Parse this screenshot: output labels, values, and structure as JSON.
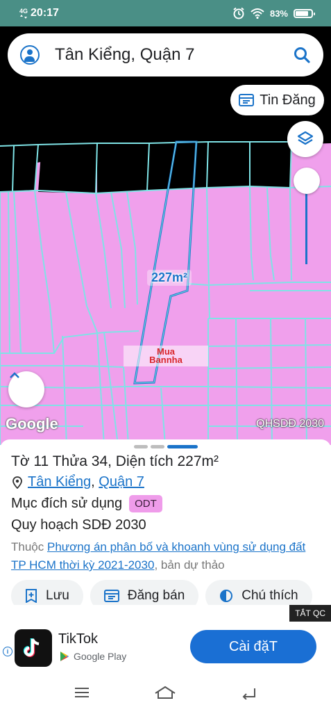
{
  "status_bar": {
    "network": "4G",
    "time": "20:17",
    "battery": "83%",
    "battery_level": 0.83
  },
  "search": {
    "query": "Tân Kiểng, Quận 7"
  },
  "map": {
    "tin_dang_label": "Tin Đăng",
    "area_label": "227m²",
    "watermark_line1": "Mua",
    "watermark_line2": "Bannha",
    "google_label": "Google",
    "layer_label": "QHSDĐ 2030"
  },
  "sheet": {
    "title": "Tờ 11 Thửa 34, Diện tích 227m²",
    "ward": "Tân Kiểng",
    "separator": ",",
    "district": "Quận 7",
    "purpose_label": "Mục đích sử dụng",
    "purpose_badge": "ODT",
    "plan_title": "Quy hoạch SDĐ 2030",
    "belongs_prefix": "Thuộc",
    "belongs_link": "Phương án phân bố và khoanh vùng sử dụng đất TP HCM thời kỳ 2021-2030",
    "belongs_suffix": ", bản dự thảo",
    "actions": [
      {
        "label": "Lưu",
        "icon": "bookmark-plus-icon"
      },
      {
        "label": "Đăng bán",
        "icon": "listing-icon"
      },
      {
        "label": "Chú thích",
        "icon": "contrast-icon"
      }
    ]
  },
  "ad": {
    "close_label": "TẮT QC",
    "app_name": "TikTok",
    "store": "Google Play",
    "install_label": "Cài đặT"
  },
  "colors": {
    "accent": "#1a73c9",
    "map_pink": "#f0a0ec",
    "parcel_line": "#7fe3e6",
    "status_bar": "#4a8f86"
  }
}
